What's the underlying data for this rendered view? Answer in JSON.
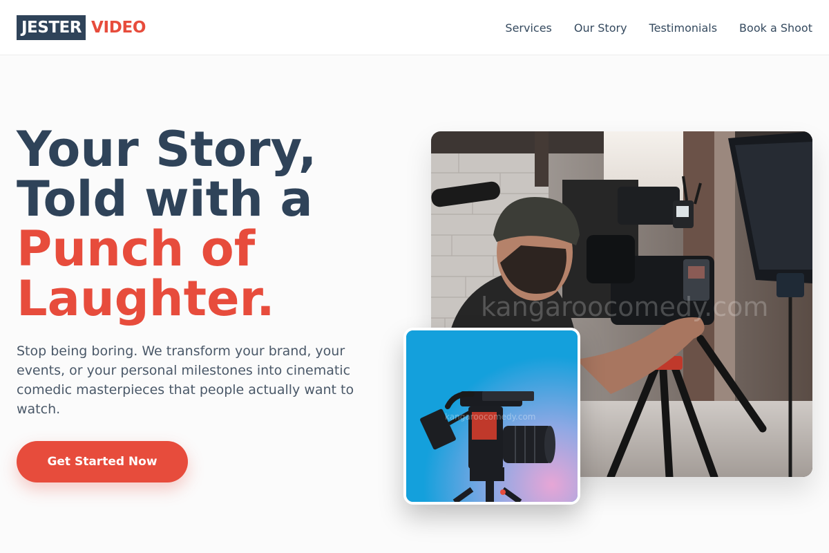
{
  "brand": {
    "primary": "JESTER",
    "accent": "VIDEO",
    "dark_color": "#2f4359",
    "accent_color": "#e74c3c"
  },
  "nav": {
    "items": [
      {
        "label": "Services"
      },
      {
        "label": "Our Story"
      },
      {
        "label": "Testimonials"
      },
      {
        "label": "Book a Shoot"
      }
    ]
  },
  "hero": {
    "title_lines": [
      "Your Story,",
      "Told with a"
    ],
    "title_accent_lines": [
      "Punch of",
      "Laughter."
    ],
    "subtitle": "Stop being boring. We transform your brand, your events, or your personal milestones into cinematic comedic masterpieces that people actually want to watch.",
    "cta_label": "Get Started Now"
  },
  "images": {
    "main_watermark": "kangaroocomedy.com",
    "small_watermark": "kangaroocomedy.com"
  }
}
